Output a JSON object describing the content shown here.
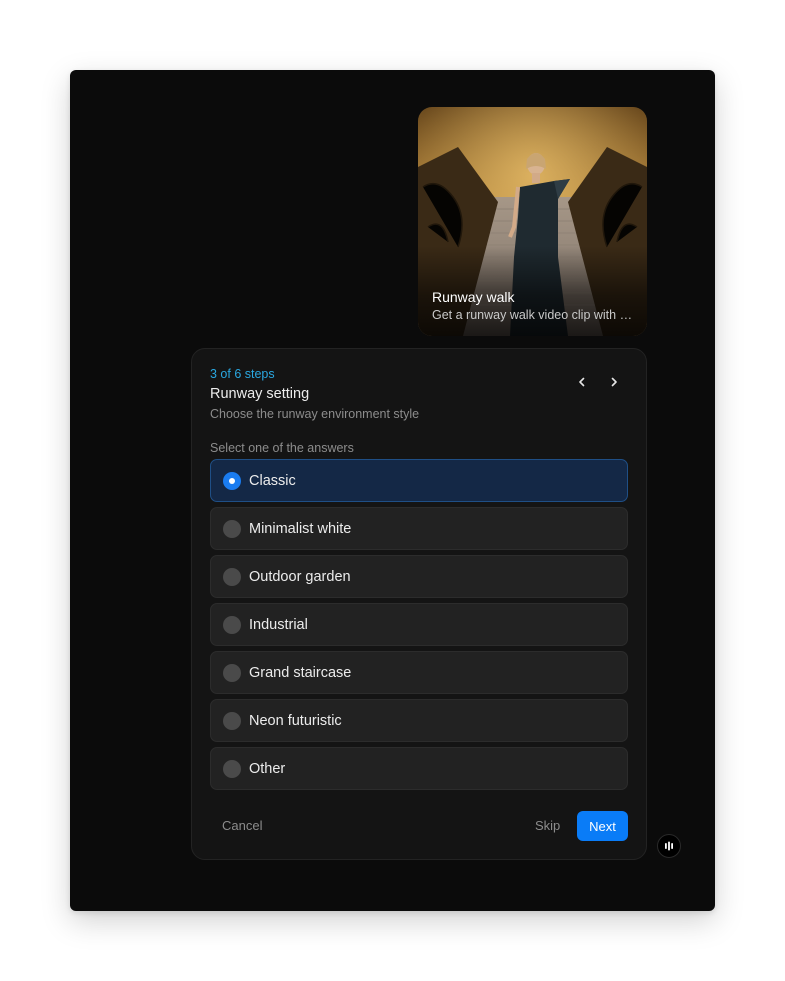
{
  "preview": {
    "title": "Runway walk",
    "description": "Get a runway walk video clip with your outfit"
  },
  "question": {
    "step": "3 of 6 steps",
    "title": "Runway setting",
    "subtitle": "Choose the runway environment style",
    "hint": "Select one of the answers",
    "options": [
      {
        "label": "Classic",
        "selected": true
      },
      {
        "label": "Minimalist white",
        "selected": false
      },
      {
        "label": "Outdoor garden",
        "selected": false
      },
      {
        "label": "Industrial",
        "selected": false
      },
      {
        "label": "Grand staircase",
        "selected": false
      },
      {
        "label": "Neon futuristic",
        "selected": false
      },
      {
        "label": "Other",
        "selected": false
      }
    ]
  },
  "actions": {
    "cancel": "Cancel",
    "skip": "Skip",
    "next": "Next"
  },
  "icons": {
    "prev": "chevron-left-icon",
    "next": "chevron-right-icon",
    "assistant": "audio-bars-icon"
  },
  "colors": {
    "accent": "#0a7cf7",
    "step_text": "#2aa7e0",
    "selected_bg": "#142846"
  }
}
